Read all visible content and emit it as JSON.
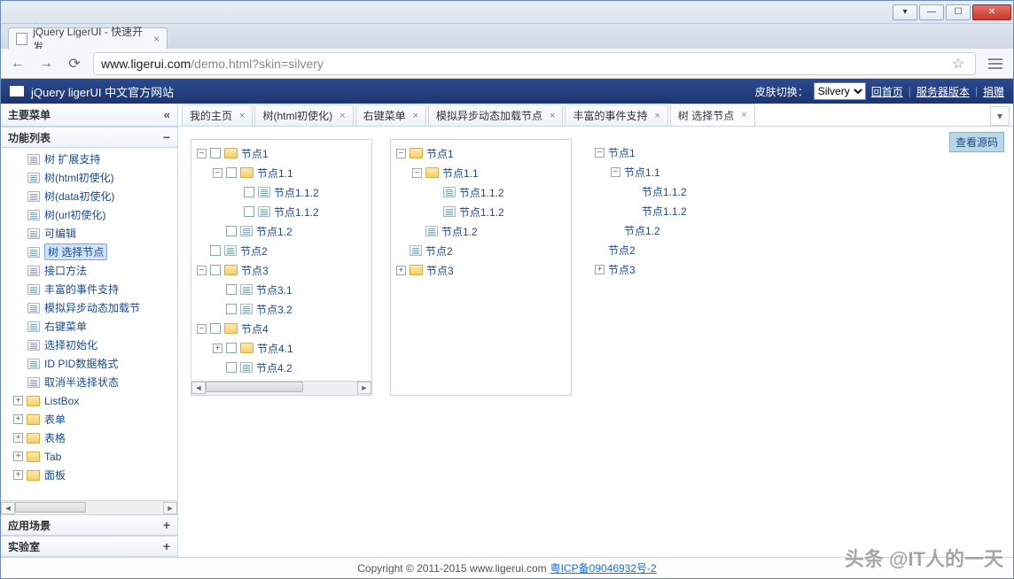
{
  "browser": {
    "tab_title": "jQuery LigerUI - 快速开发",
    "url_host": "www.ligerui.com",
    "url_path": "/demo.html",
    "url_qs": "?skin=silvery"
  },
  "header": {
    "title": "jQuery ligerUI 中文官方网站",
    "skin_label": "皮肤切换：",
    "skin_value": "Silvery",
    "link_home": "回首页",
    "link_server": "服务器版本",
    "link_donate": "捐赠"
  },
  "sidebar": {
    "title": "主要菜单",
    "sections": {
      "func": {
        "title": "功能列表",
        "sign": "−"
      },
      "scene": {
        "title": "应用场景",
        "sign": "+"
      },
      "lab": {
        "title": "实验室",
        "sign": "+"
      }
    },
    "items": [
      {
        "label": "树 扩展支持",
        "type": "leaf",
        "depth": 2
      },
      {
        "label": "树(html初使化)",
        "type": "leaf",
        "depth": 2
      },
      {
        "label": "树(data初使化)",
        "type": "leaf",
        "depth": 2
      },
      {
        "label": "树(url初使化)",
        "type": "leaf",
        "depth": 2
      },
      {
        "label": "可编辑",
        "type": "leaf",
        "depth": 2
      },
      {
        "label": "树 选择节点",
        "type": "leaf",
        "depth": 2,
        "selected": true
      },
      {
        "label": "接口方法",
        "type": "leaf",
        "depth": 2
      },
      {
        "label": "丰富的事件支持",
        "type": "leaf",
        "depth": 2
      },
      {
        "label": "模拟异步动态加载节",
        "type": "leaf",
        "depth": 2
      },
      {
        "label": "右键菜单",
        "type": "leaf",
        "depth": 2
      },
      {
        "label": "选择初始化",
        "type": "leaf",
        "depth": 2
      },
      {
        "label": "ID PID数据格式",
        "type": "leaf",
        "depth": 2
      },
      {
        "label": "取消半选择状态",
        "type": "leaf",
        "depth": 2
      },
      {
        "label": "ListBox",
        "type": "folder",
        "depth": 1,
        "exp": "+"
      },
      {
        "label": "表单",
        "type": "folder",
        "depth": 1,
        "exp": "+"
      },
      {
        "label": "表格",
        "type": "folder",
        "depth": 1,
        "exp": "+"
      },
      {
        "label": "Tab",
        "type": "folder",
        "depth": 1,
        "exp": "+"
      },
      {
        "label": "面板",
        "type": "folder",
        "depth": 1,
        "exp": "+"
      }
    ]
  },
  "tabs": [
    {
      "label": "我的主页",
      "closable": true
    },
    {
      "label": "树(html初使化)",
      "closable": true
    },
    {
      "label": "右键菜单",
      "closable": true
    },
    {
      "label": "模拟异步动态加载节点",
      "closable": true
    },
    {
      "label": "丰富的事件支持",
      "closable": true
    },
    {
      "label": "树 选择节点",
      "closable": true,
      "active": true
    }
  ],
  "view_source": "查看源码",
  "trees": {
    "a": [
      {
        "d": 0,
        "exp": "−",
        "chk": true,
        "ico": "folder",
        "label": "节点1"
      },
      {
        "d": 1,
        "exp": "−",
        "chk": true,
        "ico": "folder",
        "label": "节点1.1"
      },
      {
        "d": 2,
        "exp": "",
        "chk": true,
        "ico": "leaf",
        "label": "节点1.1.2"
      },
      {
        "d": 2,
        "exp": "",
        "chk": true,
        "ico": "leaf",
        "label": "节点1.1.2"
      },
      {
        "d": 1,
        "exp": "",
        "chk": true,
        "ico": "leaf",
        "label": "节点1.2"
      },
      {
        "d": 0,
        "exp": "",
        "chk": true,
        "ico": "leaf",
        "label": "节点2"
      },
      {
        "d": 0,
        "exp": "−",
        "chk": true,
        "ico": "folder",
        "label": "节点3"
      },
      {
        "d": 1,
        "exp": "",
        "chk": true,
        "ico": "leaf",
        "label": "节点3.1"
      },
      {
        "d": 1,
        "exp": "",
        "chk": true,
        "ico": "leaf",
        "label": "节点3.2"
      },
      {
        "d": 0,
        "exp": "−",
        "chk": true,
        "ico": "folder",
        "label": "节点4"
      },
      {
        "d": 1,
        "exp": "+",
        "chk": true,
        "ico": "folder",
        "label": "节点4.1"
      },
      {
        "d": 1,
        "exp": "",
        "chk": true,
        "ico": "leaf",
        "label": "节点4.2"
      }
    ],
    "b": [
      {
        "d": 0,
        "exp": "−",
        "ico": "folder",
        "label": "节点1"
      },
      {
        "d": 1,
        "exp": "−",
        "ico": "folder",
        "label": "节点1.1"
      },
      {
        "d": 2,
        "exp": "",
        "ico": "leaf",
        "label": "节点1.1.2"
      },
      {
        "d": 2,
        "exp": "",
        "ico": "leaf",
        "label": "节点1.1.2"
      },
      {
        "d": 1,
        "exp": "",
        "ico": "leaf",
        "label": "节点1.2"
      },
      {
        "d": 0,
        "exp": "",
        "ico": "leaf",
        "label": "节点2"
      },
      {
        "d": 0,
        "exp": "+",
        "ico": "folder",
        "label": "节点3"
      }
    ],
    "c": [
      {
        "d": 0,
        "exp": "−",
        "label": "节点1"
      },
      {
        "d": 1,
        "exp": "−",
        "label": "节点1.1"
      },
      {
        "d": 2,
        "exp": "",
        "label": "节点1.1.2"
      },
      {
        "d": 2,
        "exp": "",
        "label": "节点1.1.2"
      },
      {
        "d": 1,
        "exp": "",
        "label": "节点1.2"
      },
      {
        "d": 0,
        "exp": "",
        "label": "节点2"
      },
      {
        "d": 0,
        "exp": "+",
        "label": "节点3"
      }
    ]
  },
  "footer": {
    "copyright": "Copyright © 2011-2015 www.ligerui.com",
    "icp": "粤ICP备09046932号-2"
  },
  "watermark": "头条 @IT人的一天"
}
